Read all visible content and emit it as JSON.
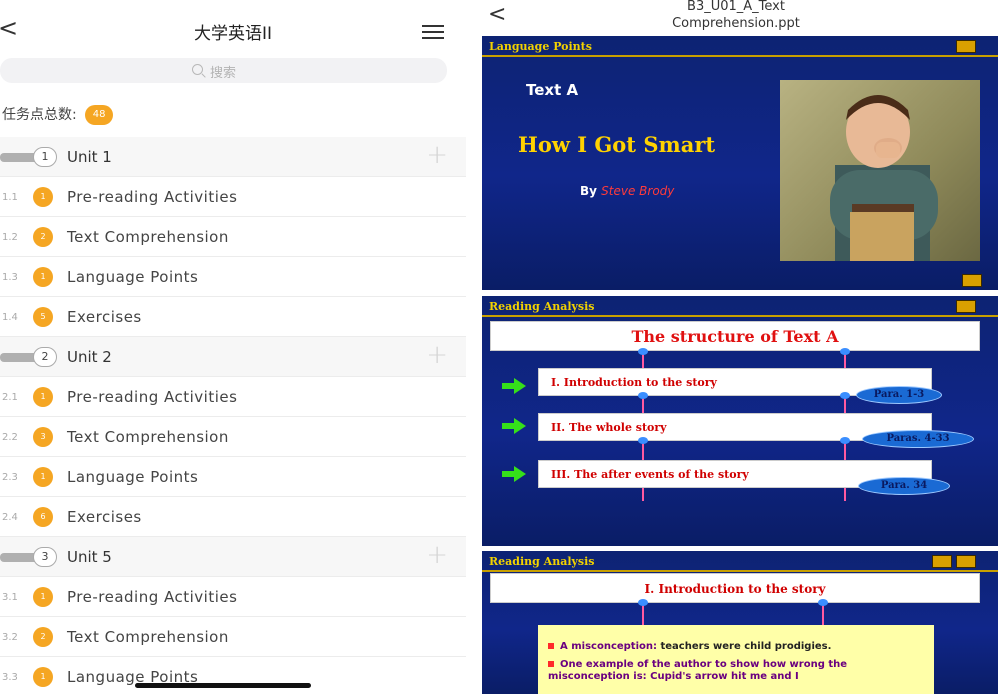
{
  "left": {
    "header": {
      "back": "<",
      "title": "大学英语II"
    },
    "search": {
      "placeholder": "搜索"
    },
    "task_count": {
      "label": "任务点总数:",
      "value": "48"
    },
    "units": [
      {
        "number": "1",
        "label": "Unit 1",
        "items": [
          {
            "num": "1.1",
            "badge": "1",
            "label": "Pre-reading Activities"
          },
          {
            "num": "1.2",
            "badge": "2",
            "label": "Text Comprehension"
          },
          {
            "num": "1.3",
            "badge": "1",
            "label": "Language Points"
          },
          {
            "num": "1.4",
            "badge": "5",
            "label": "Exercises"
          }
        ]
      },
      {
        "number": "2",
        "label": "Unit 2",
        "items": [
          {
            "num": "2.1",
            "badge": "1",
            "label": "Pre-reading Activities"
          },
          {
            "num": "2.2",
            "badge": "3",
            "label": "Text Comprehension"
          },
          {
            "num": "2.3",
            "badge": "1",
            "label": "Language Points"
          },
          {
            "num": "2.4",
            "badge": "6",
            "label": "Exercises"
          }
        ]
      },
      {
        "number": "3",
        "label": "Unit 5",
        "items": [
          {
            "num": "3.1",
            "badge": "1",
            "label": "Pre-reading Activities"
          },
          {
            "num": "3.2",
            "badge": "2",
            "label": "Text Comprehension"
          },
          {
            "num": "3.3",
            "badge": "1",
            "label": "Language Points"
          }
        ]
      }
    ],
    "plus": "+"
  },
  "right": {
    "back": "<",
    "title_line1": "B3_U01_A_Text",
    "title_line2": "Comprehension.ppt",
    "slide1": {
      "header": "Language Points",
      "text_a": "Text A",
      "title": "How I Got Smart",
      "by": "By",
      "author": "Steve Brody"
    },
    "slide2": {
      "header": "Reading Analysis",
      "title": "The structure of Text A",
      "sections": [
        {
          "text": "I.      Introduction to the story",
          "para": "Para. 1-3"
        },
        {
          "text": "II.    The whole story",
          "para": "Paras. 4-33"
        },
        {
          "text": "III.   The after events of the story",
          "para": "Para. 34"
        }
      ]
    },
    "slide3": {
      "header": "Reading Analysis",
      "intro": "I.       Introduction to the story",
      "bullet1_a": "A misconception:",
      "bullet1_b": " teachers were child prodigies.",
      "bullet2": "One example of the author to show how wrong the misconception is: Cupid's arrow hit me and I"
    }
  },
  "colors": {
    "accent_orange": "#f5a623",
    "slide_blue": "#10268a",
    "slide_header_yellow": "#f2d200",
    "title_red": "#e01010",
    "arrow_green": "#35e01a"
  }
}
